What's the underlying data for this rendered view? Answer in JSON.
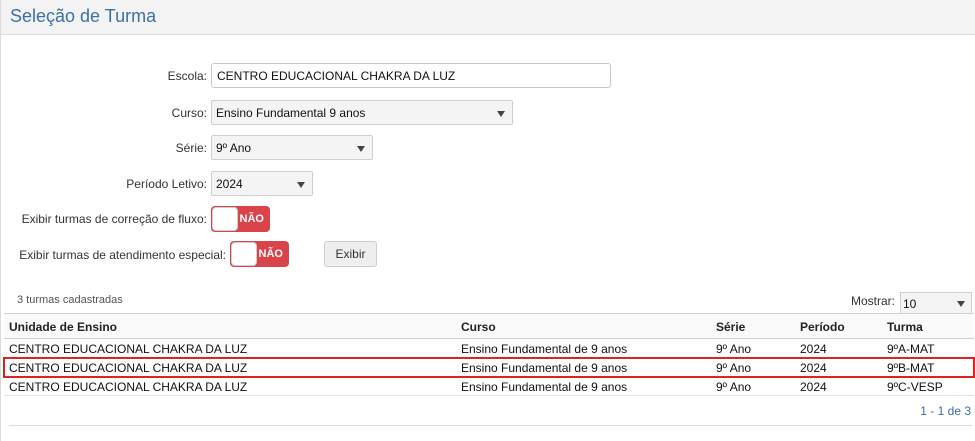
{
  "header": {
    "title": "Seleção de Turma"
  },
  "form": {
    "escola": {
      "label": "Escola:",
      "value": "CENTRO EDUCACIONAL CHAKRA DA LUZ"
    },
    "curso": {
      "label": "Curso:",
      "value": "Ensino Fundamental 9 anos"
    },
    "serie": {
      "label": "Série:",
      "value": "9º Ano"
    },
    "periodo": {
      "label": "Período Letivo:",
      "value": "2024"
    },
    "correcao_fluxo": {
      "label": "Exibir turmas de correção de fluxo:",
      "state": "NÃO"
    },
    "atendimento_especial": {
      "label": "Exibir turmas de atendimento especial:",
      "state": "NÃO"
    },
    "exibir_button": "Exibir"
  },
  "grid": {
    "count_text": "3 turmas cadastradas",
    "show_label": "Mostrar:",
    "show_value": "10",
    "columns": [
      "Unidade de Ensino",
      "Curso",
      "Série",
      "Período",
      "Turma"
    ],
    "rows": [
      [
        "CENTRO EDUCACIONAL CHAKRA DA LUZ",
        "Ensino Fundamental de 9 anos",
        "9º Ano",
        "2024",
        "9ºA-MAT"
      ],
      [
        "CENTRO EDUCACIONAL CHAKRA DA LUZ",
        "Ensino Fundamental de 9 anos",
        "9º Ano",
        "2024",
        "9ºB-MAT"
      ],
      [
        "CENTRO EDUCACIONAL CHAKRA DA LUZ",
        "Ensino Fundamental de 9 anos",
        "9º Ano",
        "2024",
        "9ºC-VESP"
      ]
    ],
    "selected_row": 1,
    "pager": "1 - 1 de 3"
  },
  "colors": {
    "accent": "#3a70a8",
    "toggle_off": "#d9434a",
    "selection": "#e02222"
  }
}
